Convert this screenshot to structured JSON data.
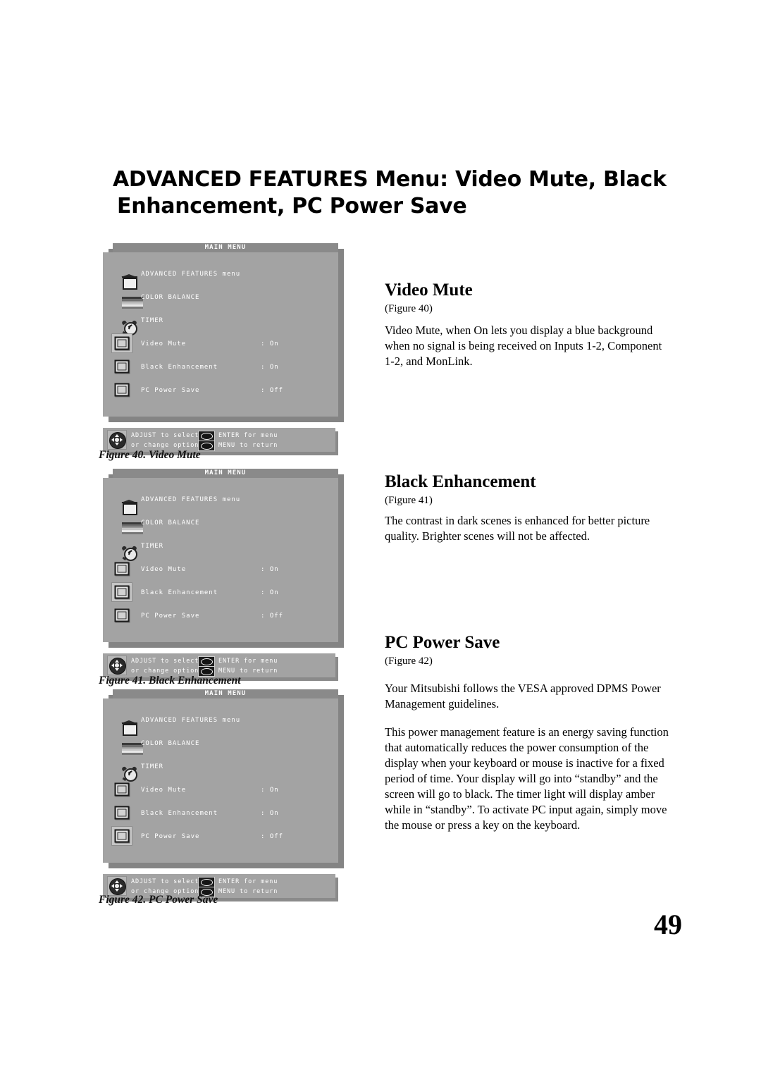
{
  "page": {
    "title_line1": "ADVANCED FEATURES Menu:  Video Mute, Black",
    "title_line2": "Enhancement, PC Power Save",
    "number": "49"
  },
  "osd": {
    "title": "MAIN MENU",
    "rows": [
      {
        "icon": "advanced-features-icon",
        "label": "ADVANCED FEATURES menu",
        "value": ""
      },
      {
        "icon": "color-balance-icon",
        "label": "COLOR BALANCE",
        "value": ""
      },
      {
        "icon": "timer-clock-icon",
        "label": "TIMER",
        "value": ""
      },
      {
        "icon": "screen-toggle-icon",
        "label": "Video Mute",
        "value": ": On"
      },
      {
        "icon": "screen-toggle-icon",
        "label": "Black Enhancement",
        "value": ": On"
      },
      {
        "icon": "screen-toggle-icon",
        "label": "PC Power Save",
        "value": ": Off"
      }
    ],
    "help": {
      "left_line1": "ADJUST to select",
      "left_line2": "or change option",
      "right_line1": "ENTER for menu",
      "right_line2": "MENU to return"
    },
    "colors": {
      "panel": "#a3a3a3",
      "titlebar": "#8a8a8a",
      "shadow": "#848484",
      "highlight": "#c6c6c6",
      "text": "#ffffff"
    }
  },
  "figures": [
    {
      "caption": "Figure 40.  Video Mute",
      "selected_row": 3
    },
    {
      "caption": "Figure 41.  Black Enhancement",
      "selected_row": 4
    },
    {
      "caption": "Figure 42.  PC Power Save",
      "selected_row": 5
    }
  ],
  "sections": [
    {
      "heading": "Video Mute",
      "figure_ref": "(Figure 40)",
      "paragraphs": [
        "Video Mute, when On lets you display a blue background when no signal is being received on Inputs 1-2,  Component 1-2, and MonLink."
      ]
    },
    {
      "heading": "Black Enhancement",
      "figure_ref": "(Figure 41)",
      "paragraphs": [
        "The contrast in dark scenes is enhanced for better picture quality.  Brighter scenes will not be affected."
      ]
    },
    {
      "heading": "PC Power Save",
      "figure_ref": "(Figure 42)",
      "paragraphs": [
        "Your Mitsubishi follows the VESA approved DPMS Power Management guidelines.",
        "This power management feature is an energy saving function that automatically reduces the power consumption of the display when your keyboard or mouse is inactive for a fixed period of time.  Your display will go into “standby” and the screen will go to black.  The timer light will display amber while in “standby”.  To activate PC input again, simply move the mouse or press a key on the keyboard."
      ]
    }
  ]
}
